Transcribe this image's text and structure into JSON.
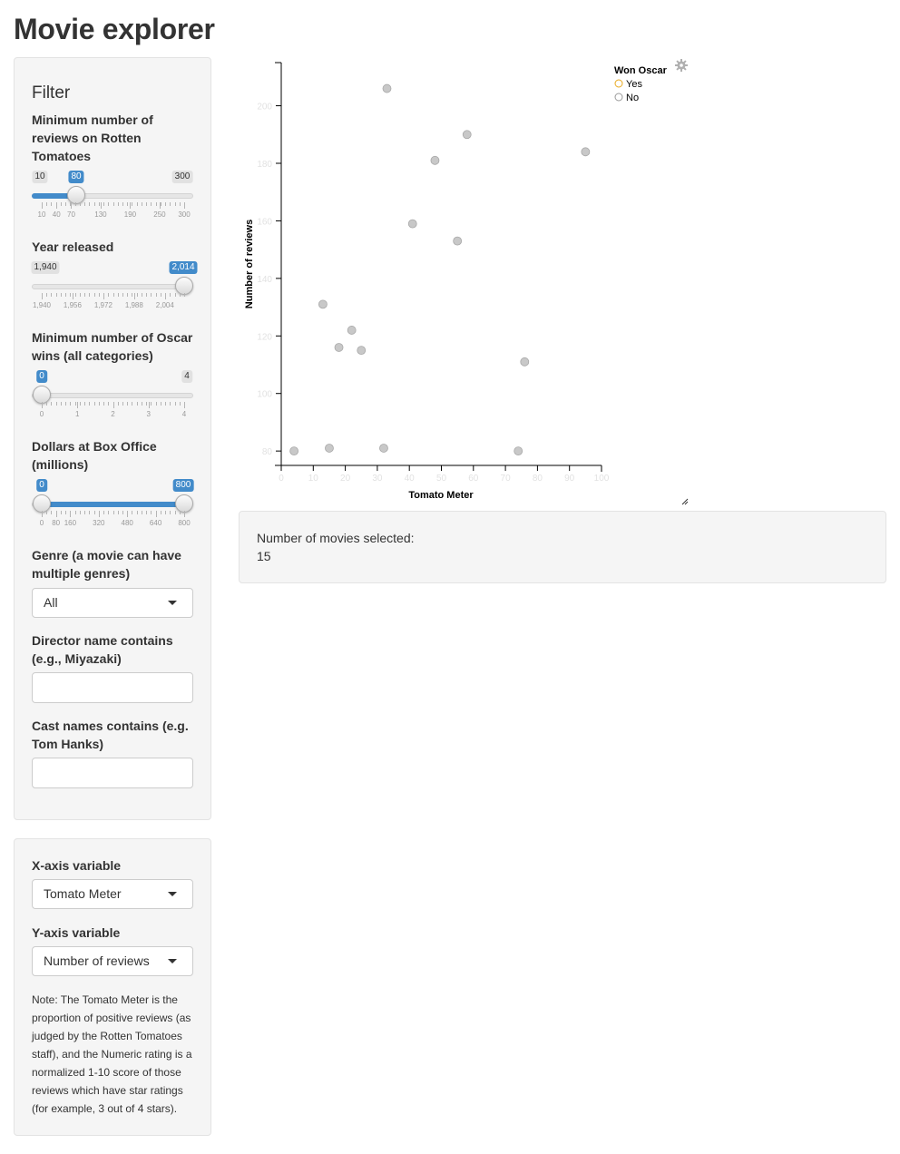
{
  "page": {
    "title": "Movie explorer"
  },
  "filter": {
    "heading": "Filter",
    "reviews": {
      "label": "Minimum number of reviews on Rotten Tomatoes",
      "min_label": "10",
      "max_label": "300",
      "value_label": "80",
      "min": 10,
      "max": 300,
      "value": 80,
      "ticks": [
        "10",
        "40",
        "70",
        "130",
        "190",
        "250",
        "300"
      ],
      "tick_values": [
        10,
        40,
        70,
        130,
        190,
        250,
        300
      ]
    },
    "year": {
      "label": "Year released",
      "min_label": "1,940",
      "value_label": "2,014",
      "min": 1940,
      "max": 2014,
      "value": 2014,
      "ticks": [
        "1,940",
        "1,956",
        "1,972",
        "1,988",
        "2,004"
      ],
      "tick_values": [
        1940,
        1956,
        1972,
        1988,
        2004
      ]
    },
    "oscars": {
      "label": "Minimum number of Oscar wins (all categories)",
      "value_label": "0",
      "max_label": "4",
      "min": 0,
      "max": 4,
      "value": 0,
      "ticks": [
        "0",
        "1",
        "2",
        "3",
        "4"
      ],
      "tick_values": [
        0,
        1,
        2,
        3,
        4
      ]
    },
    "boxoffice": {
      "label": "Dollars at Box Office (millions)",
      "low_label": "0",
      "high_label": "800",
      "min": 0,
      "max": 800,
      "low": 0,
      "high": 800,
      "ticks": [
        "0",
        "80",
        "160",
        "320",
        "480",
        "640",
        "800"
      ],
      "tick_values": [
        0,
        80,
        160,
        320,
        480,
        640,
        800
      ]
    },
    "genre": {
      "label": "Genre (a movie can have multiple genres)",
      "value": "All"
    },
    "director": {
      "label": "Director name contains (e.g., Miyazaki)",
      "value": ""
    },
    "cast": {
      "label": "Cast names contains (e.g. Tom Hanks)",
      "value": ""
    }
  },
  "axes": {
    "x_label": "X-axis variable",
    "x_value": "Tomato Meter",
    "y_label": "Y-axis variable",
    "y_value": "Number of reviews",
    "note": "Note: The Tomato Meter is the proportion of positive reviews (as judged by the Rotten Tomatoes staff), and the Numeric rating is a normalized 1-10 score of those reviews which have star ratings (for example, 3 out of 4 stars)."
  },
  "summary": {
    "label": "Number of movies selected:",
    "count": "15"
  },
  "chart_data": {
    "type": "scatter",
    "xlabel": "Tomato Meter",
    "ylabel": "Number of reviews",
    "xlim": [
      0,
      100
    ],
    "ylim": [
      75,
      215
    ],
    "x_ticks": [
      0,
      10,
      20,
      30,
      40,
      50,
      60,
      70,
      80,
      90,
      100
    ],
    "y_ticks": [
      80,
      100,
      120,
      140,
      160,
      180,
      200
    ],
    "legend": {
      "title": "Won Oscar",
      "entries": [
        "Yes",
        "No"
      ],
      "placement": "top-right"
    },
    "colors": {
      "Yes": "#e8a91f",
      "No": "#999999",
      "point": "#c8c8c8"
    },
    "series": [
      {
        "name": "No",
        "x": [
          4,
          15,
          13,
          18,
          22,
          25,
          32,
          33,
          41,
          48,
          55,
          58,
          74,
          76,
          95
        ],
        "y": [
          80,
          81,
          131,
          116,
          122,
          115,
          81,
          206,
          159,
          181,
          153,
          190,
          80,
          111,
          184
        ]
      }
    ]
  }
}
